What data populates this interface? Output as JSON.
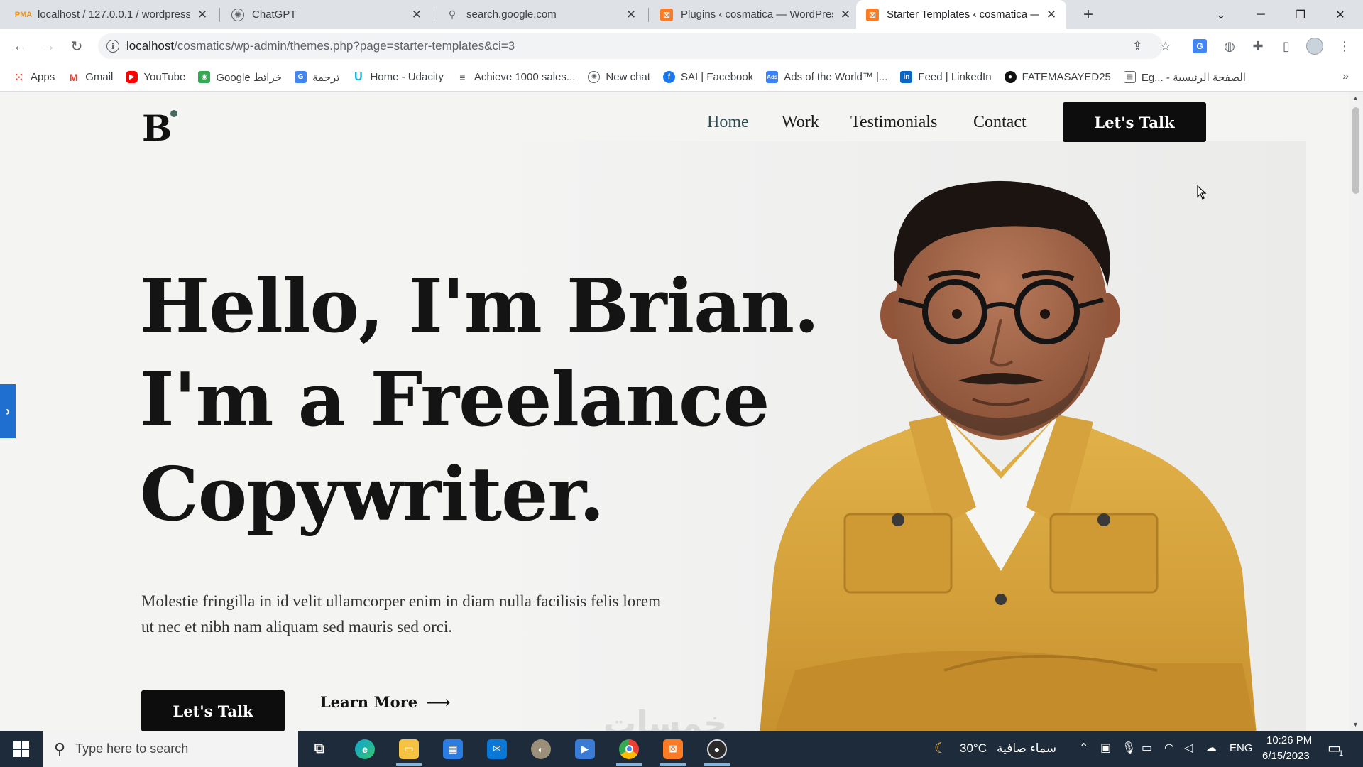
{
  "browser": {
    "tabs": [
      {
        "title": "localhost / 127.0.0.1 / wordpress",
        "favicon": "phpmyadmin-icon"
      },
      {
        "title": "ChatGPT",
        "favicon": "chatgpt-icon"
      },
      {
        "title": "search.google.com",
        "favicon": "google-search-console-icon"
      },
      {
        "title": "Plugins ‹ cosmatica — WordPress",
        "favicon": "xampp-icon"
      },
      {
        "title": "Starter Templates ‹ cosmatica —",
        "favicon": "xampp-icon",
        "active": true
      }
    ],
    "address": {
      "host": "localhost",
      "path": "/cosmatics/wp-admin/themes.php?page=starter-templates&ci=3"
    },
    "bookmarks": [
      {
        "label": "Apps",
        "icon": "apps-grid-icon",
        "color": "#ea4335"
      },
      {
        "label": "Gmail",
        "icon": "gmail-icon",
        "color": "#ea4335"
      },
      {
        "label": "YouTube",
        "icon": "youtube-icon",
        "color": "#ff0000"
      },
      {
        "label": "Google خرائط",
        "icon": "google-maps-icon",
        "color": "#34a853"
      },
      {
        "label": "ترجمة",
        "icon": "google-translate-icon",
        "color": "#4285f4"
      },
      {
        "label": "Home - Udacity",
        "icon": "udacity-icon",
        "color": "#02b3e4"
      },
      {
        "label": "Achieve 1000 sales...",
        "icon": "chart-icon",
        "color": "#555555"
      },
      {
        "label": "New chat",
        "icon": "chatgpt-icon",
        "color": "#74aa9c"
      },
      {
        "label": "SAI | Facebook",
        "icon": "facebook-icon",
        "color": "#1877f2"
      },
      {
        "label": "Ads of the World™ |...",
        "icon": "ads-icon",
        "color": "#3b82f6"
      },
      {
        "label": "Feed | LinkedIn",
        "icon": "linkedin-icon",
        "color": "#0a66c2"
      },
      {
        "label": "FATEMASAYED25",
        "icon": "github-icon",
        "color": "#111111"
      },
      {
        "label": "Eg... - الصفحة الرئيسية",
        "icon": "page-icon",
        "color": "#666666"
      }
    ]
  },
  "site": {
    "logo": "B",
    "nav": [
      "Home",
      "Work",
      "Testimonials",
      "Contact"
    ],
    "cta": "Let's Talk",
    "hero_lines": [
      "Hello, I'm Brian.",
      "I'm a Freelance",
      "Copywriter."
    ],
    "paragraph": "Molestie fringilla in id velit ullamcorper enim in diam nulla facilisis felis lorem ut nec et nibh nam aliquam sed mauris sed orci.",
    "primary_button": "Let's Talk",
    "secondary_button": "Learn More"
  },
  "taskbar": {
    "search_placeholder": "Type here to search",
    "weather": "30°C",
    "weather_desc": "سماء صافية",
    "language": "ENG",
    "time": "10:26 PM",
    "date": "6/15/2023",
    "notifications": "1"
  },
  "colors": {
    "accent_blue": "#1f6fd1",
    "dark": "#0d0d0d",
    "jacket": "#d9a73a"
  }
}
